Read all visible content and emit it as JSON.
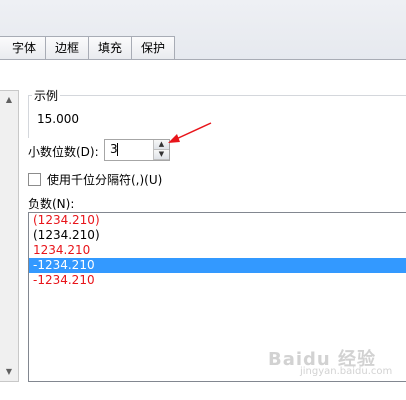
{
  "tabs": [
    "字体",
    "边框",
    "填充",
    "保护"
  ],
  "sample": {
    "legend": "示例",
    "value": "15.000"
  },
  "decimals": {
    "label": "小数位数(D):",
    "value": "3"
  },
  "thousand_separator": {
    "label": "使用千位分隔符(,)(U)",
    "checked": false
  },
  "negatives": {
    "label": "负数(N):",
    "items": [
      {
        "text": "(1234.210)",
        "color": "red",
        "selected": false
      },
      {
        "text": "(1234.210)",
        "color": "black",
        "selected": false
      },
      {
        "text": "1234.210",
        "color": "red",
        "selected": false
      },
      {
        "text": "-1234.210",
        "color": "black",
        "selected": true
      },
      {
        "text": "-1234.210",
        "color": "red",
        "selected": false
      }
    ]
  },
  "colors": {
    "red": "#e8141a",
    "selection": "#3399ff",
    "annotation_arrow": "#e8141a"
  },
  "watermark": {
    "main": "Baidu 经验",
    "sub": "jingyan.baidu.com"
  }
}
